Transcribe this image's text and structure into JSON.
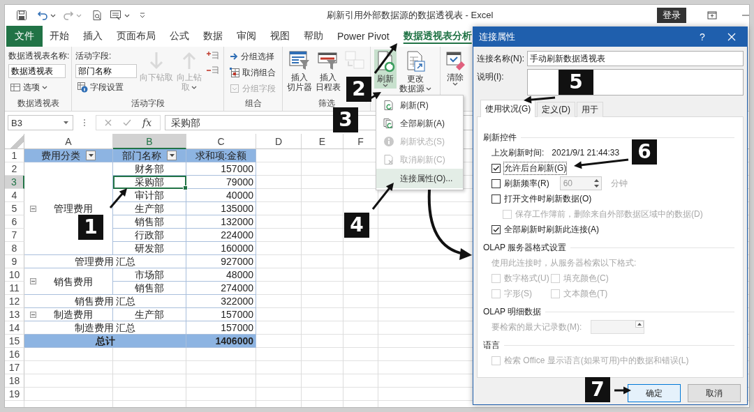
{
  "window": {
    "title": "刷新引用外部数据源的数据透视表 - Excel",
    "sign_in": "登录"
  },
  "ribbon_tabs": [
    {
      "label": "文件",
      "kind": "file",
      "selected": false
    },
    {
      "label": "开始",
      "kind": "tab",
      "selected": false
    },
    {
      "label": "插入",
      "kind": "tab",
      "selected": false
    },
    {
      "label": "页面布局",
      "kind": "tab",
      "selected": false
    },
    {
      "label": "公式",
      "kind": "tab",
      "selected": false
    },
    {
      "label": "数据",
      "kind": "tab",
      "selected": false
    },
    {
      "label": "审阅",
      "kind": "tab",
      "selected": false
    },
    {
      "label": "视图",
      "kind": "tab",
      "selected": false
    },
    {
      "label": "帮助",
      "kind": "tab",
      "selected": false
    },
    {
      "label": "Power Pivot",
      "kind": "tab",
      "selected": false
    },
    {
      "label": "数据透视表分析",
      "kind": "tab",
      "selected": true
    }
  ],
  "ribbon": {
    "groups": [
      {
        "label": "数据透视表",
        "columns": [
          [
            {
              "kind": "caption",
              "text": "数据透视表名称:"
            },
            {
              "kind": "field",
              "value": "数据透视表"
            },
            {
              "kind": "small",
              "label": "选项",
              "caret": true,
              "disabled": false
            }
          ]
        ]
      },
      {
        "label": "活动字段",
        "columns": [
          [
            {
              "kind": "caption",
              "text": "活动字段:"
            },
            {
              "kind": "field",
              "value": "部门名称"
            },
            {
              "kind": "small",
              "label": "字段设置",
              "disabled": false
            }
          ],
          [
            {
              "kind": "large",
              "label": [
                "向下钻取"
              ],
              "disabled": true
            }
          ],
          [
            {
              "kind": "large",
              "label": [
                "向上钻",
                "取"
              ],
              "caret": true,
              "disabled": true
            }
          ],
          [
            {
              "kind": "icon",
              "disabled": false
            },
            {
              "kind": "icon",
              "disabled": false
            }
          ]
        ]
      },
      {
        "label": "组合",
        "columns": [
          [
            {
              "kind": "small",
              "label": "分组选择",
              "disabled": false
            },
            {
              "kind": "small",
              "label": "取消组合",
              "disabled": false
            },
            {
              "kind": "small",
              "label": "分组字段",
              "disabled": true
            }
          ]
        ]
      },
      {
        "label": "筛选",
        "columns": [
          [
            {
              "kind": "large",
              "label": [
                "插入",
                "切片器"
              ],
              "disabled": false
            }
          ],
          [
            {
              "kind": "large",
              "label": [
                "插入",
                "日程表"
              ],
              "disabled": false
            }
          ],
          [
            {
              "kind": "large",
              "disabled": true
            }
          ]
        ]
      },
      {
        "columns": [
          [
            {
              "kind": "large",
              "label": [
                "刷新"
              ],
              "caret": true,
              "pressed": true,
              "disabled": false
            }
          ],
          [
            {
              "kind": "large",
              "label": [
                "更改",
                "数据源"
              ],
              "caret": true,
              "pressed": false,
              "disabled": false
            }
          ]
        ]
      },
      {
        "columns": [
          [
            {
              "kind": "large",
              "label": [
                "清除"
              ],
              "caret": true,
              "disabled": false
            }
          ]
        ]
      }
    ]
  },
  "formula_bar": {
    "name_box": "B3",
    "function_button": "fx",
    "formula": "采购部"
  },
  "sheet": {
    "columns": [
      {
        "label": "A",
        "selected": false
      },
      {
        "label": "B",
        "selected": true
      },
      {
        "label": "C",
        "selected": false
      },
      {
        "label": "D",
        "selected": false
      },
      {
        "label": "E",
        "selected": false
      },
      {
        "label": "F",
        "selected": false
      }
    ],
    "rows": [
      {
        "label": "1",
        "selected": false
      },
      {
        "label": "2",
        "selected": false
      },
      {
        "label": "3",
        "selected": true
      },
      {
        "label": "4",
        "selected": false
      },
      {
        "label": "5",
        "selected": false
      },
      {
        "label": "6",
        "selected": false
      },
      {
        "label": "7",
        "selected": false
      },
      {
        "label": "8",
        "selected": false
      },
      {
        "label": "9",
        "selected": false
      },
      {
        "label": "10",
        "selected": false
      },
      {
        "label": "11",
        "selected": false
      },
      {
        "label": "12",
        "selected": false
      },
      {
        "label": "13",
        "selected": false
      },
      {
        "label": "14",
        "selected": false
      },
      {
        "label": "15",
        "selected": false
      },
      {
        "label": "16",
        "selected": false
      },
      {
        "label": "17",
        "selected": false
      },
      {
        "label": "18",
        "selected": false
      },
      {
        "label": "19",
        "selected": false
      }
    ],
    "pivot": {
      "headers": [
        {
          "label": "费用分类",
          "filter": true
        },
        {
          "label": "部门名称",
          "filter": true
        },
        {
          "label": "求和项:金额",
          "filter": false
        }
      ],
      "groups": [
        {
          "category": "管理费用",
          "expanded": true,
          "items": [
            {
              "department": "财务部",
              "amount": "157000",
              "selected": false
            },
            {
              "department": "采购部",
              "amount": "79000",
              "selected": true
            },
            {
              "department": "审计部",
              "amount": "40000",
              "selected": false
            },
            {
              "department": "生产部",
              "amount": "135000",
              "selected": false
            },
            {
              "department": "销售部",
              "amount": "132000",
              "selected": false
            },
            {
              "department": "行政部",
              "amount": "224000",
              "selected": false
            },
            {
              "department": "研发部",
              "amount": "160000",
              "selected": false
            }
          ],
          "subtotal_label": "管理费用 汇总",
          "subtotal": "927000"
        },
        {
          "category": "销售费用",
          "expanded": true,
          "items": [
            {
              "department": "市场部",
              "amount": "48000",
              "selected": false
            },
            {
              "department": "销售部",
              "amount": "274000",
              "selected": false
            }
          ],
          "subtotal_label": "销售费用 汇总",
          "subtotal": "322000"
        },
        {
          "category": "制造费用",
          "expanded": true,
          "items": [
            {
              "department": "生产部",
              "amount": "157000",
              "selected": false
            }
          ],
          "subtotal_label": "制造费用 汇总",
          "subtotal": "157000"
        }
      ],
      "total_label": "总计",
      "total": "1406000"
    }
  },
  "menu": {
    "items": [
      {
        "label": "刷新(R)",
        "disabled": false,
        "selected": false
      },
      {
        "label": "全部刷新(A)",
        "disabled": false,
        "selected": false
      },
      {
        "label": "刷新状态(S)",
        "disabled": true,
        "selected": false
      },
      {
        "label": "取消刷新(C)",
        "disabled": true,
        "selected": false
      },
      {
        "label": "连接属性(O)...",
        "disabled": false,
        "selected": true
      }
    ]
  },
  "dialog": {
    "title": "连接属性",
    "help": "?",
    "name_label": "连接名称(N):",
    "name_value": "手动刷新数据透视表",
    "description_label": "说明(I):",
    "tabs": [
      {
        "label": "使用状况(G)",
        "selected": true
      },
      {
        "label": "定义(D)",
        "selected": false
      },
      {
        "label": "用于",
        "selected": false
      }
    ],
    "sections": [
      {
        "title": "刷新控件",
        "items": [
          {
            "kind": "info",
            "label": "上次刷新时间:",
            "value": "2021/9/1  21:44:33"
          },
          {
            "kind": "checkbox",
            "label": "允许后台刷新(G)",
            "checked": true,
            "disabled": false,
            "focused": true
          },
          {
            "kind": "spin",
            "label": "刷新频率(R)",
            "checked": false,
            "disabled": false,
            "value": "60",
            "unit": "分钟"
          },
          {
            "kind": "checkbox",
            "label": "打开文件时刷新数据(O)",
            "checked": false,
            "disabled": false
          },
          {
            "kind": "sub",
            "label": "保存工作簿前，删除来自外部数据区域中的数据(D)",
            "checked": false,
            "disabled": true
          },
          {
            "kind": "checkbox",
            "label": "全部刷新时刷新此连接(A)",
            "checked": true,
            "disabled": false
          }
        ]
      },
      {
        "title": "OLAP 服务器格式设置",
        "items": [
          {
            "kind": "note",
            "label": "使用此连接时，从服务器检索以下格式:",
            "disabled": true
          },
          {
            "kind": "pair",
            "options": [
              {
                "label": "数字格式(U)",
                "checked": false,
                "disabled": true
              },
              {
                "label": "填充颜色(C)",
                "checked": false,
                "disabled": true
              }
            ]
          },
          {
            "kind": "pair",
            "options": [
              {
                "label": "字形(S)",
                "checked": false,
                "disabled": true
              },
              {
                "label": "文本颜色(T)",
                "checked": false,
                "disabled": true
              }
            ]
          }
        ]
      },
      {
        "title": "OLAP 明细数据",
        "items": [
          {
            "kind": "field",
            "label": "要检索的最大记录数(M):",
            "disabled": true
          }
        ]
      },
      {
        "title": "语言",
        "items": [
          {
            "kind": "checkbox",
            "label": "检索 Office 显示语言(如果可用)中的数据和错误(L)",
            "checked": false,
            "disabled": true
          }
        ]
      }
    ],
    "buttons": [
      {
        "label": "确定",
        "kind": "default"
      },
      {
        "label": "取消",
        "kind": "normal"
      }
    ]
  },
  "annotations": [
    {
      "label": "1"
    },
    {
      "label": "2"
    },
    {
      "label": "3"
    },
    {
      "label": "4"
    },
    {
      "label": "5"
    },
    {
      "label": "6"
    },
    {
      "label": "7"
    }
  ]
}
